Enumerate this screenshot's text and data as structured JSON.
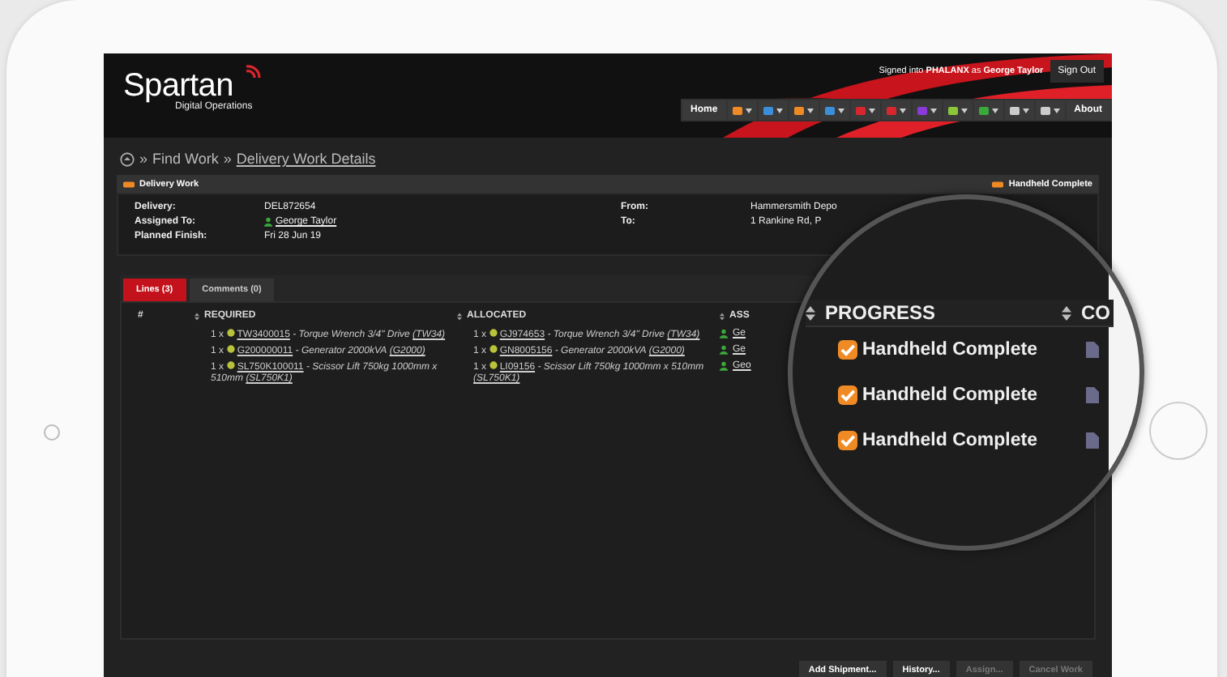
{
  "header": {
    "logo": "Spartan",
    "logo_subtitle": "Digital Operations",
    "signed_in": "Signed into **PHALANX** as **George Taylor**",
    "sign_out": "Sign Out"
  },
  "nav": {
    "home": "Home",
    "about": "About"
  },
  "breadcrumb": {
    "separator_1": "»",
    "item": "Find Work",
    "separator_2": "»",
    "current": "Delivery Work Details"
  },
  "panel": {
    "title": "Delivery Work",
    "status": "Handheld Complete",
    "left_fields": [
      {
        "label": "Delivery:",
        "value": "DEL872654",
        "kind": "text"
      },
      {
        "label": "Assigned To:",
        "value": "George Taylor",
        "kind": "user"
      },
      {
        "label": "Planned Finish:",
        "value": "Fri 28 Jun 19",
        "kind": "text"
      }
    ],
    "right_fields": [
      {
        "label": "From:",
        "value": "Hammersmith Depo",
        "kind": "text"
      },
      {
        "label": "To:",
        "value": "1 Rankine Rd, P",
        "kind": "text"
      }
    ]
  },
  "tabs": [
    {
      "label": "Lines (3)",
      "selected": true
    },
    {
      "label": "Comments (0)",
      "selected": false
    }
  ],
  "table": {
    "columns": [
      "#",
      "REQUIRED",
      "ALLOCATED",
      "ASS"
    ],
    "rows": [
      {
        "required": {
          "qty": "1 x",
          "code": "TW3400015",
          "description": "- Torque Wrench 3/4\" Drive",
          "model": "(TW34)"
        },
        "allocated": {
          "qty": "1 x",
          "code": "GJ974653",
          "description": "- Torque Wrench 3/4\" Drive",
          "model": "(TW34)"
        },
        "assignee": "Ge"
      },
      {
        "required": {
          "qty": "1 x",
          "code": "G200000011",
          "description": "- Generator 2000kVA",
          "model": "(G2000)"
        },
        "allocated": {
          "qty": "1 x",
          "code": "GN8005156",
          "description": "- Generator 2000kVA",
          "model": "(G2000)"
        },
        "assignee": "Ge"
      },
      {
        "required": {
          "qty": "1 x",
          "code": "SL750K100011",
          "description": "- Scissor Lift 750kg 1000mm x 510mm",
          "model": "(SL750K1)"
        },
        "allocated": {
          "qty": "1 x",
          "code": "LI09156",
          "description": "- Scissor Lift 750kg 1000mm x 510mm",
          "model": "(SL750K1)"
        },
        "assignee": "Geo"
      }
    ]
  },
  "magnifier": {
    "columns": [
      "PROGRESS",
      "CO"
    ],
    "rows": [
      {
        "checked": true,
        "label": "Handheld Complete"
      },
      {
        "checked": true,
        "label": "Handheld Complete"
      },
      {
        "checked": true,
        "label": "Handheld Complete"
      }
    ]
  },
  "footer_buttons": [
    {
      "label": "Add Shipment...",
      "disabled": false
    },
    {
      "label": "History...",
      "disabled": false
    },
    {
      "label": "Assign...",
      "disabled": true
    },
    {
      "label": "Cancel Work",
      "disabled": true
    }
  ]
}
